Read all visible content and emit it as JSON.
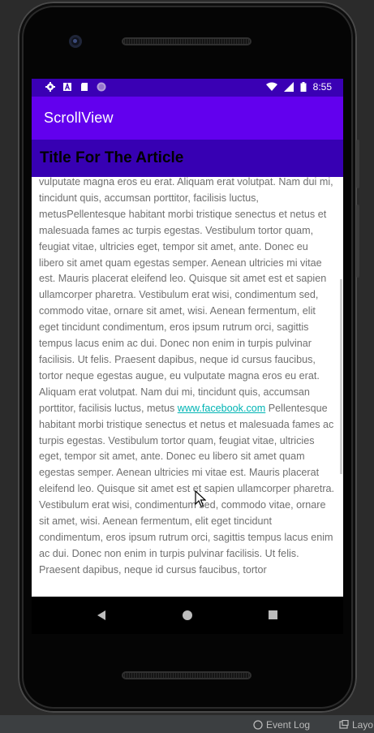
{
  "status_bar": {
    "time": "8:55",
    "icons_left": [
      "gear-icon",
      "a-badge-icon",
      "sd-card-icon",
      "circle-icon"
    ],
    "icons_right": [
      "wifi-icon",
      "signal-icon",
      "battery-icon"
    ]
  },
  "app_bar": {
    "title": "ScrollView"
  },
  "article": {
    "heading": "Title For The Article",
    "text_before_link": "vulputate magna eros eu erat. Aliquam erat volutpat. Nam dui mi, tincidunt quis, accumsan porttitor, facilisis luctus, metusPellentesque habitant morbi tristique senectus et netus et malesuada fames ac turpis egestas. Vestibulum tortor quam, feugiat vitae, ultricies eget, tempor sit amet, ante. Donec eu libero sit amet quam egestas semper. Aenean ultricies mi vitae est. Mauris placerat eleifend leo. Quisque sit amet est et sapien ullamcorper pharetra. Vestibulum erat wisi, condimentum sed, commodo vitae, ornare sit amet, wisi. Aenean fermentum, elit eget tincidunt condimentum, eros ipsum rutrum orci, sagittis tempus lacus enim ac dui. Donec non enim in turpis pulvinar facilisis. Ut felis. Praesent dapibus, neque id cursus faucibus, tortor neque egestas augue, eu vulputate magna eros eu erat. Aliquam erat volutpat. Nam dui mi, tincidunt quis, accumsan porttitor, facilisis luctus, metus ",
    "link_text": "www.facebook.com",
    "text_after_link": " Pellentesque habitant morbi tristique senectus et netus et malesuada fames ac turpis egestas. Vestibulum tortor quam, feugiat vitae, ultricies eget, tempor sit amet, ante. Donec eu libero sit amet quam egestas semper. Aenean ultricies mi vitae est. Mauris placerat eleifend leo. Quisque sit amet est et sapien ullamcorper pharetra. Vestibulum erat wisi, condimentum sed, commodo vitae, ornare sit amet, wisi. Aenean fermentum, elit eget tincidunt condimentum, eros ipsum rutrum orci, sagittis tempus lacus enim ac dui. Donec non enim in turpis pulvinar facilisis. Ut felis. Praesent dapibus, neque id cursus faucibus, tortor"
  },
  "nav_bar": {
    "buttons": [
      "back-icon",
      "home-icon",
      "recents-icon"
    ]
  },
  "ide_status": {
    "event_log": "Event Log",
    "layout_partial": "Layo"
  },
  "colors": {
    "status_bar": "#3a00b4",
    "app_bar": "#6200ee",
    "article_header": "#3700b3",
    "link": "#00b4b4",
    "body_text": "#6f6f6f"
  }
}
